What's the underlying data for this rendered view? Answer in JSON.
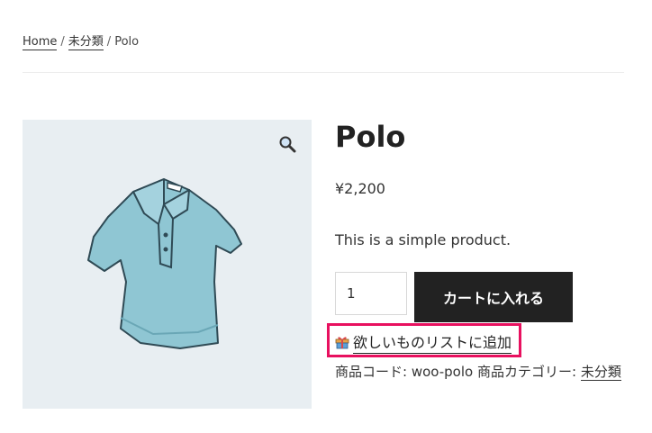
{
  "breadcrumb": {
    "home": "Home",
    "category": "未分類",
    "current": "Polo",
    "separator": "/"
  },
  "product": {
    "title": "Polo",
    "price": "¥2,200",
    "description": "This is a simple product.",
    "quantity": "1",
    "add_to_cart_label": "カートに入れる",
    "wishlist_label": "欲しいものリストに追加",
    "sku_label": "商品コード:",
    "sku_value": "woo-polo",
    "category_label": "商品カテゴリー:",
    "category_value": "未分類"
  },
  "icons": {
    "zoom": "magnifier-icon",
    "wishlist": "gift-icon"
  },
  "colors": {
    "highlight_border": "#e8105f",
    "button_bg": "#222222",
    "gallery_bg": "#e8eef2"
  }
}
